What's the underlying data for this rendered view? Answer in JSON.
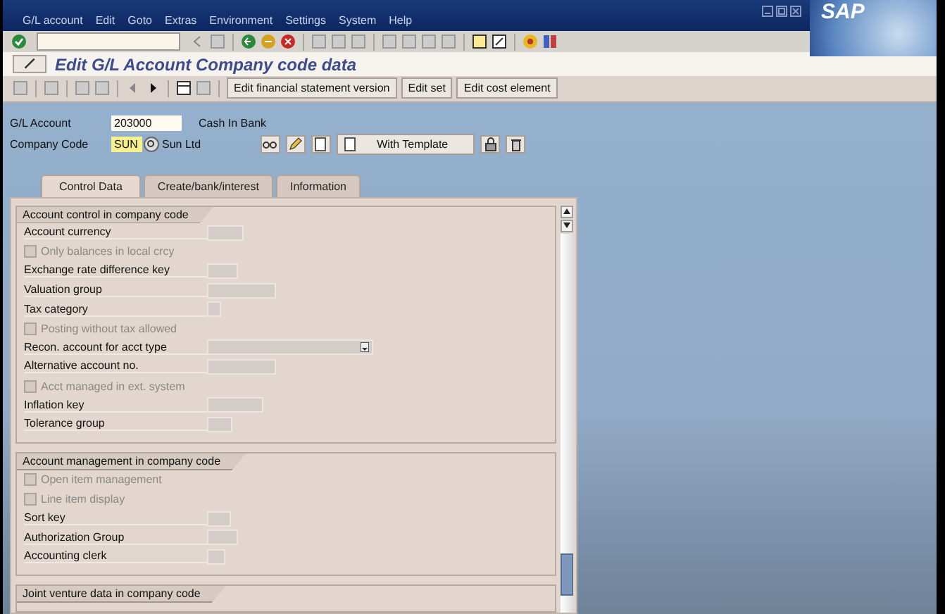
{
  "menu": [
    "G/L account",
    "Edit",
    "Goto",
    "Extras",
    "Environment",
    "Settings",
    "System",
    "Help"
  ],
  "logo": "SAP",
  "title": "Edit G/L Account Company code data",
  "app_toolbar": [
    "Edit financial statement version",
    "Edit set",
    "Edit cost element"
  ],
  "header": [
    {
      "label": "G/L Account",
      "value": "203000",
      "description": "Cash In Bank",
      "focused": false
    },
    {
      "label": "Company Code",
      "value": "SUN",
      "description": "Sun Ltd",
      "focused": true
    }
  ],
  "template_button": "With Template",
  "tabs": [
    {
      "label": "Control Data",
      "selected": true
    },
    {
      "label": "Create/bank/interest",
      "selected": false
    },
    {
      "label": "Information",
      "selected": false
    }
  ],
  "sections": [
    {
      "title": "Account control in company code",
      "rows": [
        {
          "kind": "field",
          "label": "Account currency"
        },
        {
          "kind": "checkbox",
          "label": "Only balances in local crcy",
          "checked": false,
          "disabled": true
        },
        {
          "kind": "field",
          "label": "Exchange rate difference key"
        },
        {
          "kind": "field",
          "label": "Valuation group"
        },
        {
          "kind": "field",
          "label": "Tax category"
        },
        {
          "kind": "checkbox",
          "label": "Posting without tax allowed",
          "checked": false,
          "disabled": true
        },
        {
          "kind": "dropdown",
          "label": "Recon. account for acct type"
        },
        {
          "kind": "field",
          "label": "Alternative account no."
        },
        {
          "kind": "checkbox",
          "label": "Acct managed in ext. system",
          "checked": false,
          "disabled": true
        },
        {
          "kind": "field",
          "label": "Inflation key"
        },
        {
          "kind": "field",
          "label": "Tolerance group"
        }
      ]
    },
    {
      "title": "Account management in company code",
      "rows": [
        {
          "kind": "checkbox",
          "label": "Open item management",
          "checked": false,
          "disabled": true
        },
        {
          "kind": "checkbox",
          "label": "Line item display",
          "checked": false,
          "disabled": true
        },
        {
          "kind": "field",
          "label": "Sort key"
        },
        {
          "kind": "field",
          "label": "Authorization Group"
        },
        {
          "kind": "field",
          "label": "Accounting clerk"
        }
      ]
    },
    {
      "title": "Joint venture data in company code"
    }
  ]
}
